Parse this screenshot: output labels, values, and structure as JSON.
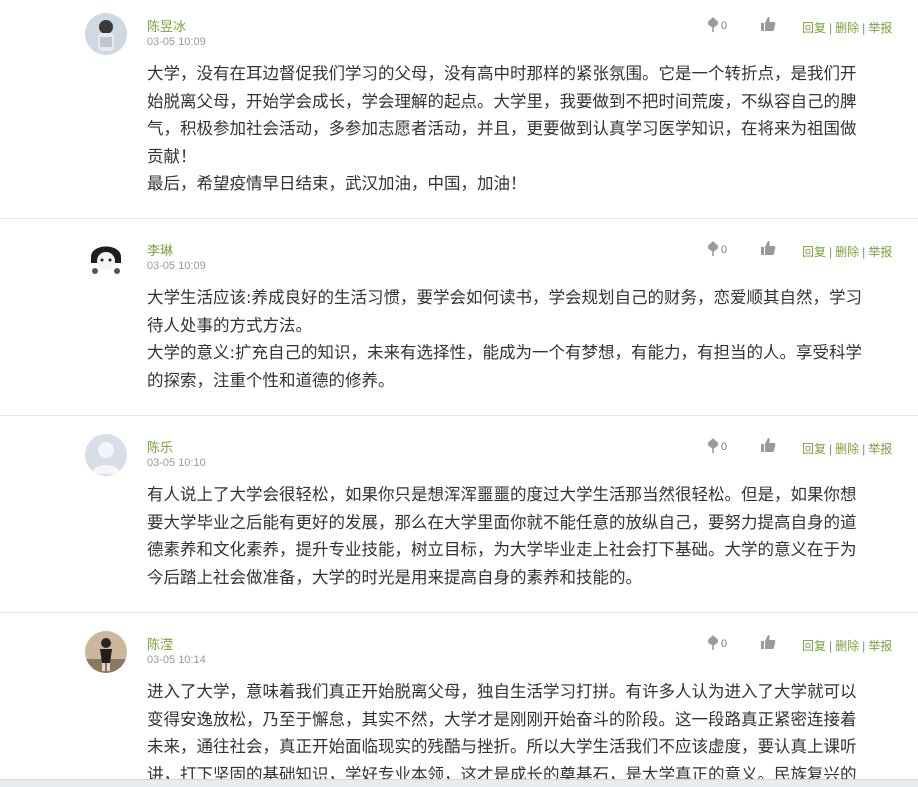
{
  "comments": [
    {
      "author": "陈昱冰",
      "time": "03-05 10:09",
      "flower_count": "0",
      "reply": "回复",
      "delete": "删除",
      "report": "举报",
      "lines": [
        "大学，没有在耳边督促我们学习的父母，没有高中时那样的紧张氛围。它是一个转折点，是我们开",
        "始脱离父母，开始学会成长，学会理解的起点。大学里，我要做到不把时间荒废，不纵容自己的脾",
        "气，积极参加社会活动，多参加志愿者活动，并且，更要做到认真学习医学知识，在将来为祖国做",
        "贡献！",
        "最后，希望疫情早日结束，武汉加油，中国，加油！"
      ]
    },
    {
      "author": "李琳",
      "time": "03-05 10:09",
      "flower_count": "0",
      "reply": "回复",
      "delete": "删除",
      "report": "举报",
      "lines": [
        "大学生活应该:养成良好的生活习惯，要学会如何读书，学会规划自己的财务，恋爱顺其自然，学习",
        "待人处事的方式方法。",
        "大学的意义:扩充自己的知识，未来有选择性，能成为一个有梦想，有能力，有担当的人。享受科学",
        "的探索，注重个性和道德的修养。"
      ]
    },
    {
      "author": "陈乐",
      "time": "03-05 10:10",
      "flower_count": "0",
      "reply": "回复",
      "delete": "删除",
      "report": "举报",
      "lines": [
        "有人说上了大学会很轻松，如果你只是想浑浑噩噩的度过大学生活那当然很轻松。但是，如果你想",
        "要大学毕业之后能有更好的发展，那么在大学里面你就不能任意的放纵自己，要努力提高自身的道",
        "德素养和文化素养，提升专业技能，树立目标，为大学毕业走上社会打下基础。大学的意义在于为",
        "今后踏上社会做准备，大学的时光是用来提高自身的素养和技能的。"
      ]
    },
    {
      "author": "陈滢",
      "time": "03-05 10:14",
      "flower_count": "0",
      "reply": "回复",
      "delete": "删除",
      "report": "举报",
      "lines": [
        "进入了大学，意味着我们真正开始脱离父母，独自生活学习打拼。有许多人认为进入了大学就可以",
        "变得安逸放松，乃至于懈怠，其实不然，大学才是刚刚开始奋斗的阶段。这一段路真正紧密连接着",
        "未来，通往社会，真正开始面临现实的残酷与挫折。所以大学生活我们不应该虚度，要认真上课听",
        "讲，打下坚固的基础知识，学好专业本领，这才是成长的奠基石，是大学真正的意义。民族复兴的"
      ]
    }
  ],
  "colors": {
    "accent_green": "#7aa23f",
    "time_gray": "#999999",
    "divider": "#e6e6e6"
  },
  "icons": {
    "flower": "flower-icon",
    "like": "thumbs-up-icon"
  }
}
